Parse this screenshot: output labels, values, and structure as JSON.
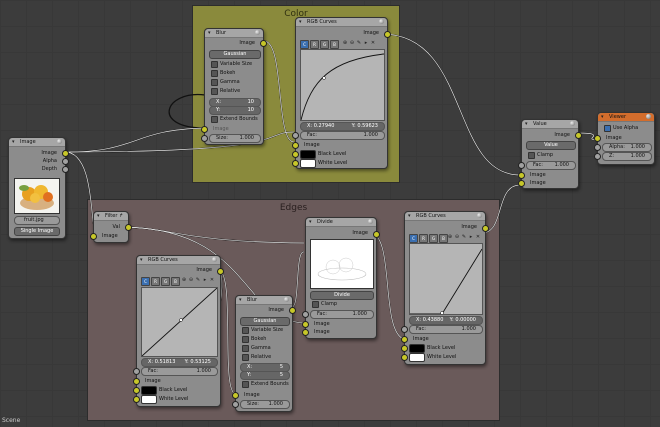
{
  "frames": {
    "color": {
      "label": "Color"
    },
    "edges": {
      "label": "Edges"
    }
  },
  "image_node": {
    "title": "Image",
    "outputs": [
      "Image",
      "Alpha",
      "Depth"
    ],
    "file": "fruit.jpg",
    "source": "Single Image"
  },
  "blur1": {
    "title": "Blur",
    "output": "Image",
    "filter": "Gaussian",
    "checks": [
      {
        "label": "Variable Size",
        "on": false
      },
      {
        "label": "Bokeh",
        "on": false
      },
      {
        "label": "Gamma",
        "on": false
      },
      {
        "label": "Relative",
        "on": false
      }
    ],
    "x_label": "X:",
    "x_value": "10",
    "y_label": "Y:",
    "y_value": "10",
    "extend_label": "Extend Bounds",
    "input_label": "Image",
    "size_label": "Size:",
    "size_value": "1.000"
  },
  "curves1": {
    "title": "RGB Curves",
    "output": "Image",
    "tabs": [
      "C",
      "R",
      "G",
      "B"
    ],
    "x_label": "X:",
    "x_value": "0.27940",
    "y_label": "Y:",
    "y_value": "0.59623",
    "fac_label": "Fac:",
    "fac_value": "1.000",
    "image_label": "Image",
    "black_label": "Black Level",
    "white_label": "White Level"
  },
  "value_node": {
    "title": "Value",
    "output": "Image",
    "op": "Value",
    "clamp_label": "Clamp",
    "fac_label": "Fac:",
    "fac_value": "1.000",
    "in1": "Image",
    "in2": "Image"
  },
  "viewer": {
    "title": "Viewer",
    "use_alpha_label": "Use Alpha",
    "image_label": "Image",
    "alpha_label": "Alpha:",
    "alpha_value": "1.000",
    "z_label": "Z:",
    "z_value": "1.000"
  },
  "filter_node": {
    "title": "Filter ↱",
    "out": "Val",
    "in": "Image"
  },
  "curves2": {
    "title": "RGB Curves",
    "output": "Image",
    "tabs": [
      "C",
      "R",
      "G",
      "B"
    ],
    "x_label": "X:",
    "x_value": "0.51813",
    "y_label": "Y:",
    "y_value": "0.53125",
    "fac_label": "Fac:",
    "fac_value": "1.000",
    "image_label": "Image",
    "black_label": "Black Level",
    "white_label": "White Level"
  },
  "blur2": {
    "title": "Blur",
    "output": "Image",
    "filter": "Gaussian",
    "checks": [
      {
        "label": "Variable Size",
        "on": false
      },
      {
        "label": "Bokeh",
        "on": false
      },
      {
        "label": "Gamma",
        "on": false
      },
      {
        "label": "Relative",
        "on": false
      }
    ],
    "x_label": "X:",
    "x_value": "5",
    "y_label": "Y:",
    "y_value": "5",
    "extend_label": "Extend Bounds",
    "input_label": "Image",
    "size_label": "Size:",
    "size_value": "1.000"
  },
  "divide_node": {
    "title": "Divide",
    "output": "Image",
    "op": "Divide",
    "clamp_label": "Clamp",
    "fac_label": "Fac:",
    "fac_value": "1.000",
    "in1": "Image",
    "in2": "Image"
  },
  "curves3": {
    "title": "RGB Curves",
    "output": "Image",
    "tabs": [
      "C",
      "R",
      "G",
      "B"
    ],
    "x_label": "X:",
    "x_value": "0.43880",
    "y_label": "Y:",
    "y_value": "0.00000",
    "fac_label": "Fac:",
    "fac_value": "1.000",
    "image_label": "Image",
    "black_label": "Black Level",
    "white_label": "White Level"
  },
  "status_bar": {
    "scene": "Scene"
  },
  "colors": {
    "frame_color": "#8a8a3c",
    "frame_edges": "#6a5a5a",
    "node_bg": "#8c8c8c",
    "viewer_header": "#d36d2c",
    "socket_image": "#c7c729",
    "socket_value": "#a1a1a1",
    "socket_vector": "#6363c7"
  },
  "icons": [
    "node-collapse-arrow-icon",
    "node-preview-ball-icon",
    "curve-zoom-in-icon",
    "curve-zoom-out-icon",
    "curve-tools-icon",
    "curve-clip-icon",
    "curve-delete-icon"
  ]
}
